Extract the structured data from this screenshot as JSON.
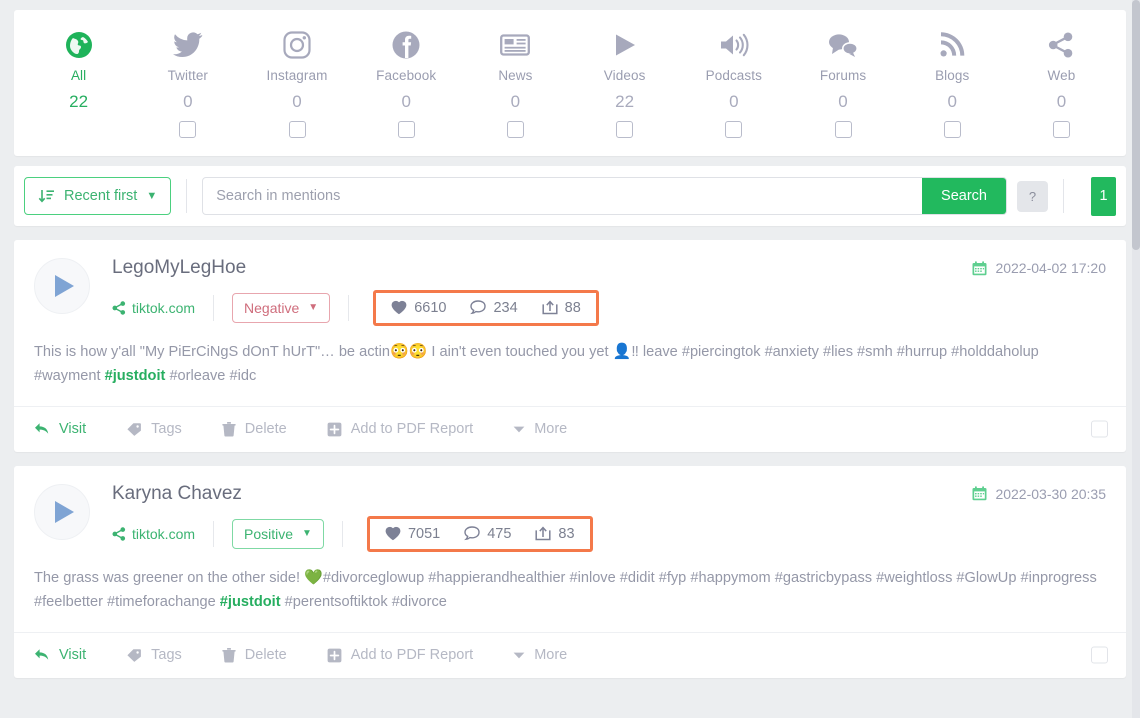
{
  "source_tabs": [
    {
      "label": "All",
      "count": "22",
      "icon": "globe-icon",
      "active": true
    },
    {
      "label": "Twitter",
      "count": "0",
      "icon": "twitter-icon",
      "active": false
    },
    {
      "label": "Instagram",
      "count": "0",
      "icon": "instagram-icon",
      "active": false
    },
    {
      "label": "Facebook",
      "count": "0",
      "icon": "facebook-icon",
      "active": false
    },
    {
      "label": "News",
      "count": "0",
      "icon": "news-icon",
      "active": false
    },
    {
      "label": "Videos",
      "count": "22",
      "icon": "video-play-icon",
      "active": false
    },
    {
      "label": "Podcasts",
      "count": "0",
      "icon": "speaker-icon",
      "active": false
    },
    {
      "label": "Forums",
      "count": "0",
      "icon": "forums-icon",
      "active": false
    },
    {
      "label": "Blogs",
      "count": "0",
      "icon": "rss-icon",
      "active": false
    },
    {
      "label": "Web",
      "count": "0",
      "icon": "share-icon",
      "active": false
    }
  ],
  "toolbar": {
    "sort_label": "Recent first",
    "sort_icon": "sort-descending-icon",
    "search_value": "",
    "search_placeholder": "Search in mentions",
    "search_button": "Search",
    "help_button": "?",
    "page_number": "1"
  },
  "colors": {
    "accent_green": "#22b95e",
    "highlight_orange": "#f4794a",
    "negative": "#cf6d7c",
    "positive": "#3cb371",
    "muted_text": "#9598a8"
  },
  "mentions": [
    {
      "author": "LegoMyLegHoe",
      "domain": "tiktok.com",
      "sentiment": "Negative",
      "sentiment_kind": "negative",
      "likes": "6610",
      "comments": "234",
      "shares": "88",
      "date": "2022-04-02 17:20",
      "text_parts": [
        {
          "t": "This is how y'all \"My PiErCiNgS dOnT hUrT\"… be actin",
          "hl": false
        },
        {
          "t": "😳😳",
          "hl": false,
          "emoji": true
        },
        {
          "t": " I ain't even touched you yet ",
          "hl": false
        },
        {
          "t": "👤‼",
          "hl": false,
          "emoji": true
        },
        {
          "t": " leave #piercingtok #anxiety #lies #smh #hurrup #holddaholup #wayment ",
          "hl": false
        },
        {
          "t": "#justdoit",
          "hl": true
        },
        {
          "t": " #orleave #idc",
          "hl": false
        }
      ],
      "actions": [
        {
          "label": "Visit",
          "icon": "visit-arrow-icon",
          "kind": "visit"
        },
        {
          "label": "Tags",
          "icon": "tag-icon",
          "kind": "tags"
        },
        {
          "label": "Delete",
          "icon": "trash-icon",
          "kind": "delete"
        },
        {
          "label": "Add to PDF Report",
          "icon": "add-to-pdf-icon",
          "kind": "pdf"
        },
        {
          "label": "More",
          "icon": "caret-down-icon",
          "kind": "more"
        }
      ]
    },
    {
      "author": "Karyna Chavez",
      "domain": "tiktok.com",
      "sentiment": "Positive",
      "sentiment_kind": "positive",
      "likes": "7051",
      "comments": "475",
      "shares": "83",
      "date": "2022-03-30 20:35",
      "text_parts": [
        {
          "t": "The grass was greener on the other side! ",
          "hl": false
        },
        {
          "t": "💚",
          "hl": false,
          "emoji": true
        },
        {
          "t": "#divorceglowup #happierandhealthier #inlove #didit #fyp #happymom #gastricbypass #weightloss #GlowUp #inprogress #feelbetter #timeforachange ",
          "hl": false
        },
        {
          "t": "#justdoit",
          "hl": true
        },
        {
          "t": " #perentsoftiktok #divorce",
          "hl": false
        }
      ],
      "actions": [
        {
          "label": "Visit",
          "icon": "visit-arrow-icon",
          "kind": "visit"
        },
        {
          "label": "Tags",
          "icon": "tag-icon",
          "kind": "tags"
        },
        {
          "label": "Delete",
          "icon": "trash-icon",
          "kind": "delete"
        },
        {
          "label": "Add to PDF Report",
          "icon": "add-to-pdf-icon",
          "kind": "pdf"
        },
        {
          "label": "More",
          "icon": "caret-down-icon",
          "kind": "more"
        }
      ]
    }
  ]
}
